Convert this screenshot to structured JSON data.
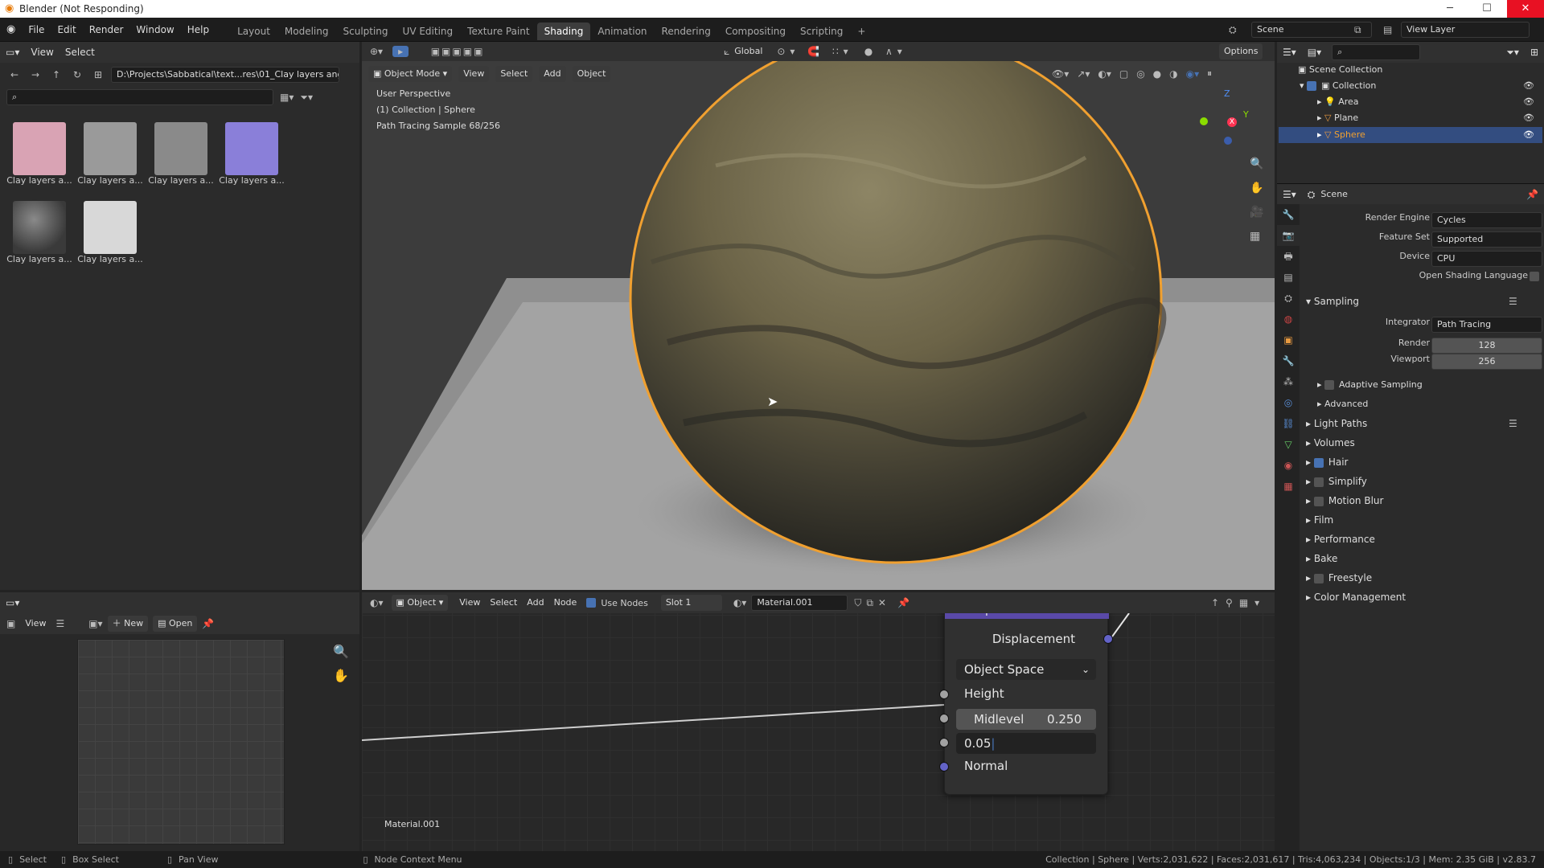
{
  "window": {
    "title": "Blender (Not Responding)",
    "controls": {
      "minimize": "─",
      "maximize": "☐",
      "close": "✕"
    }
  },
  "menu": [
    "File",
    "Edit",
    "Render",
    "Window",
    "Help"
  ],
  "workspaces": [
    "Layout",
    "Modeling",
    "Sculpting",
    "UV Editing",
    "Texture Paint",
    "Shading",
    "Animation",
    "Rendering",
    "Compositing",
    "Scripting"
  ],
  "active_workspace": "Shading",
  "add_workspace": "+",
  "scene_name": "Scene",
  "view_layer": "View Layer",
  "file_browser": {
    "header": {
      "view": "View",
      "select": "Select"
    },
    "path": "D:\\Projects\\Sabbatical\\text...res\\01_Clay layers angular\\",
    "thumbnails": [
      {
        "label": "Clay layers a...",
        "color": "#d9a3b4"
      },
      {
        "label": "Clay layers a...",
        "color": "#9a9a9a"
      },
      {
        "label": "Clay layers a...",
        "color": "#8a8a8a"
      },
      {
        "label": "Clay layers a...",
        "color": "#8a7fd9"
      },
      {
        "label": "Clay layers a...",
        "color": "#5e5e5e"
      },
      {
        "label": "Clay layers a...",
        "color": "#d8d8d8"
      }
    ]
  },
  "image_editor": {
    "view": "View",
    "new": "New",
    "open": "Open"
  },
  "viewport": {
    "header": {
      "mode": "Object Mode",
      "view": "View",
      "select": "Select",
      "add": "Add",
      "object": "Object",
      "orientation": "Global",
      "options": "Options"
    },
    "overlay_lines": [
      "User Perspective",
      "(1) Collection | Sphere",
      "Path Tracing Sample 68/256"
    ],
    "gizmo": {
      "z": "Z",
      "y": "Y",
      "x": "X"
    }
  },
  "node_editor": {
    "header": {
      "type": "Object",
      "view": "View",
      "select": "Select",
      "add": "Add",
      "node": "Node",
      "use_nodes": "Use Nodes",
      "slot": "Slot 1",
      "material": "Material.001"
    },
    "material_label": "Material.001",
    "node": {
      "title": "Displacement",
      "output": "Displacement",
      "space": "Object Space",
      "height": "Height",
      "midlevel_label": "Midlevel",
      "midlevel_value": "0.250",
      "scale_value": "0.05",
      "normal": "Normal"
    }
  },
  "outliner": {
    "root": "Scene Collection",
    "items": [
      {
        "name": "Collection",
        "level": 1
      },
      {
        "name": "Area",
        "level": 2
      },
      {
        "name": "Plane",
        "level": 2
      },
      {
        "name": "Sphere",
        "level": 2,
        "selected": true
      }
    ]
  },
  "properties": {
    "context": "Scene",
    "render_engine": {
      "label": "Render Engine",
      "value": "Cycles"
    },
    "feature_set": {
      "label": "Feature Set",
      "value": "Supported"
    },
    "device": {
      "label": "Device",
      "value": "CPU"
    },
    "osl": "Open Shading Language",
    "sampling": {
      "title": "Sampling",
      "integrator": {
        "label": "Integrator",
        "value": "Path Tracing"
      },
      "render": {
        "label": "Render",
        "value": "128"
      },
      "viewport": {
        "label": "Viewport",
        "value": "256"
      },
      "adaptive": "Adaptive Sampling",
      "advanced": "Advanced"
    },
    "sections": [
      {
        "label": "Light Paths",
        "checkbox": false
      },
      {
        "label": "Volumes",
        "checkbox": false
      },
      {
        "label": "Hair",
        "checkbox": true,
        "checked": true
      },
      {
        "label": "Simplify",
        "checkbox": true,
        "checked": false
      },
      {
        "label": "Motion Blur",
        "checkbox": true,
        "checked": false
      },
      {
        "label": "Film",
        "checkbox": false
      },
      {
        "label": "Performance",
        "checkbox": false
      },
      {
        "label": "Bake",
        "checkbox": false
      },
      {
        "label": "Freestyle",
        "checkbox": true,
        "checked": false
      },
      {
        "label": "Color Management",
        "checkbox": false
      }
    ]
  },
  "statusbar": {
    "select": "Select",
    "box_select": "Box Select",
    "pan_view": "Pan View",
    "context_menu": "Node Context Menu",
    "stats": "Collection | Sphere | Verts:2,031,622 | Faces:2,031,617 | Tris:4,063,234 | Objects:1/3 | Mem: 2.35 GiB | v2.83.7"
  },
  "colors": {
    "accent": "#4772b3",
    "selection_outline": "#f0a030",
    "node_header": "#5a49a8"
  }
}
